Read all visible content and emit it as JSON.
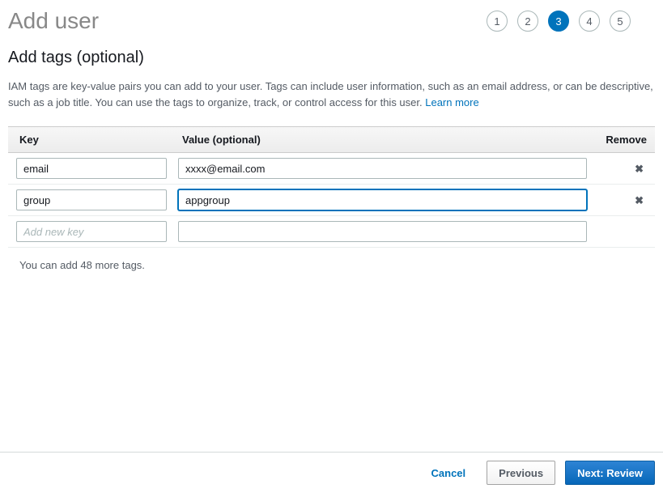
{
  "header": {
    "title": "Add user",
    "steps": [
      {
        "label": "1",
        "active": false
      },
      {
        "label": "2",
        "active": false
      },
      {
        "label": "3",
        "active": true
      },
      {
        "label": "4",
        "active": false
      },
      {
        "label": "5",
        "active": false
      }
    ]
  },
  "section": {
    "title": "Add tags (optional)",
    "description": "IAM tags are key-value pairs you can add to your user. Tags can include user information, such as an email address, or can be descriptive, such as a job title. You can use the tags to organize, track, or control access for this user. ",
    "learn_more": "Learn more"
  },
  "table": {
    "headers": {
      "key": "Key",
      "value": "Value (optional)",
      "remove": "Remove"
    },
    "rows": [
      {
        "key": "email",
        "value": "xxxx@email.com",
        "removable": true,
        "focused": false
      },
      {
        "key": "group",
        "value": "appgroup",
        "removable": true,
        "focused": true
      }
    ],
    "new_row": {
      "key_placeholder": "Add new key",
      "value": ""
    },
    "remaining": "You can add 48 more tags."
  },
  "footer": {
    "cancel": "Cancel",
    "previous": "Previous",
    "next": "Next: Review"
  }
}
